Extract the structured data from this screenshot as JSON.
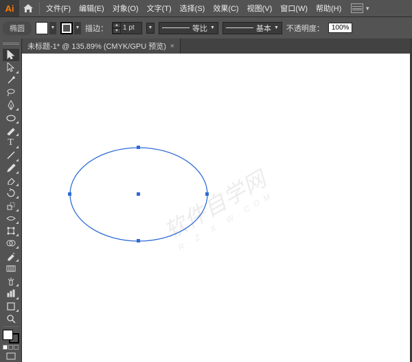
{
  "app": {
    "logo": "Ai"
  },
  "menu": {
    "items": [
      "文件(F)",
      "编辑(E)",
      "对象(O)",
      "文字(T)",
      "选择(S)",
      "效果(C)",
      "视图(V)",
      "窗口(W)",
      "帮助(H)"
    ]
  },
  "options": {
    "tool_label": "椭圆",
    "stroke_label": "描边：",
    "stroke_pt": "1 pt",
    "profile1_label": "等比",
    "profile2_label": "基本",
    "opacity_label": "不透明度：",
    "opacity_value": "100%"
  },
  "doc_tab": {
    "title": "未标题-1* @ 135.89% (CMYK/GPU 预览)",
    "close": "×"
  },
  "watermark": {
    "main": "软件自学网",
    "sub": "R · Z · X · W · C O M"
  },
  "icons": {
    "home": "home-icon",
    "panel": "panel-menu-icon",
    "selection": "selection-tool",
    "direct": "direct-selection-tool",
    "wand": "magic-wand-tool",
    "lasso": "lasso-tool",
    "pen": "pen-tool",
    "curvature": "curvature-tool",
    "type": "type-tool",
    "line": "line-tool",
    "ellipse": "ellipse-tool",
    "brush": "paintbrush-tool",
    "pencil": "pencil-tool",
    "eraser": "eraser-tool",
    "rotate": "rotate-tool",
    "scale": "scale-tool",
    "width": "width-tool",
    "free": "free-transform-tool",
    "shapebuilder": "shape-builder-tool",
    "perspective": "perspective-grid-tool",
    "mesh": "mesh-tool",
    "gradient": "gradient-tool",
    "eyedropper": "eyedropper-tool",
    "blend": "blend-tool",
    "symbol": "symbol-sprayer-tool",
    "graph": "column-graph-tool",
    "artboard": "artboard-tool",
    "slice": "slice-tool",
    "zoom": "zoom-tool"
  }
}
